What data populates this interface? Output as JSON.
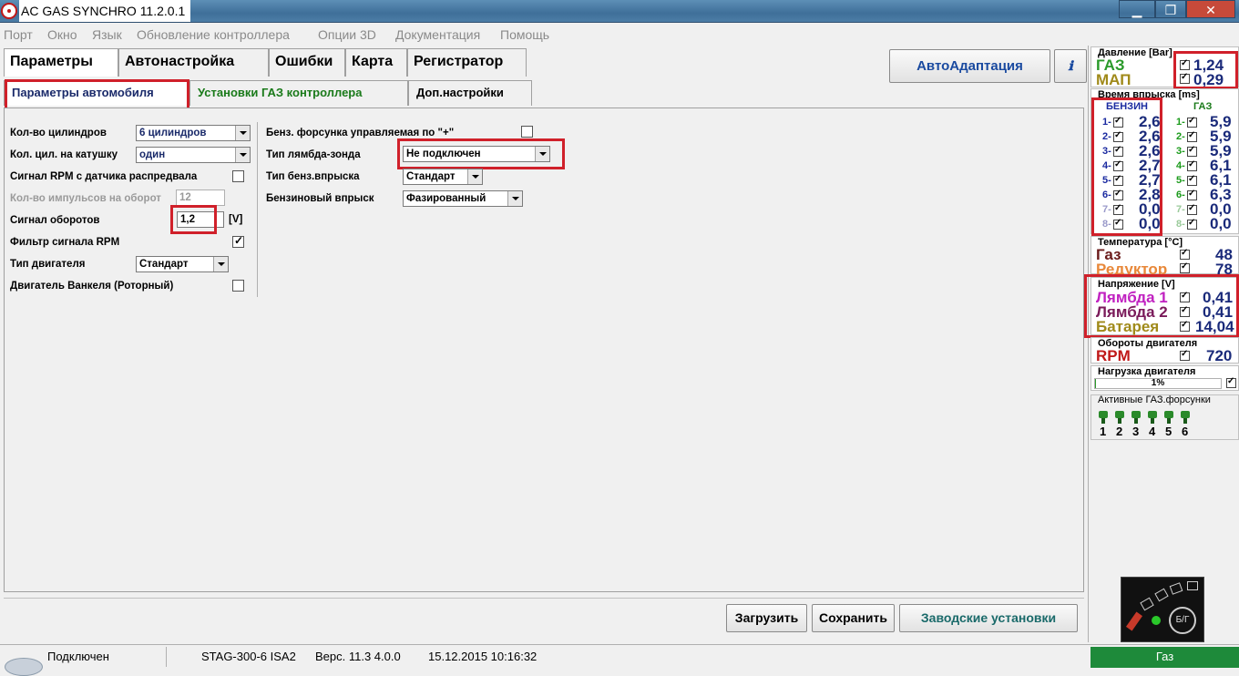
{
  "window": {
    "title": "AC GAS SYNCHRO  11.2.0.1",
    "btn_min": "▁",
    "btn_max": "❐",
    "btn_close": "✕"
  },
  "menu": [
    "Порт",
    "Окно",
    "Язык",
    "Обновление контроллера",
    "Опции 3D",
    "Документация",
    "Помощь"
  ],
  "main_tabs": [
    "Параметры",
    "Автонастройка",
    "Ошибки",
    "Карта",
    "Регистратор"
  ],
  "autoadapt_label": "АвтоАдаптация",
  "sub_tabs": [
    "Параметры автомобиля",
    "Установки ГАЗ контроллера",
    "Доп.настройки"
  ],
  "left": {
    "cyl_label": "Кол-во цилиндров",
    "cyl_value": "6 цилиндров",
    "coil_label": "Кол. цил. на катушку",
    "coil_value": "один",
    "rpm_cam_label": "Сигнал RPM с датчика распредвала",
    "pulses_label": "Кол-во импульсов на оборот",
    "pulses_value": "12",
    "rpm_signal_label": "Сигнал оборотов",
    "rpm_signal_value": "1,2",
    "rpm_signal_unit": "[V]",
    "rpm_filter_label": "Фильтр сигнала RPM",
    "engine_type_label": "Тип двигателя",
    "engine_type_value": "Стандарт",
    "wankel_label": "Двигатель Ванкеля (Роторный)"
  },
  "right": {
    "injector_plus_label": "Бенз. форсунка управляемая по \"+\"",
    "lambda_label": "Тип лямбда-зонда",
    "lambda_value": "Не подключен",
    "petrol_inj_type_label": "Тип бенз.впрыска",
    "petrol_inj_type_value": "Стандарт",
    "petrol_inj_label": "Бензиновый впрыск",
    "petrol_inj_value": "Фазированный"
  },
  "buttons": {
    "load": "Загрузить",
    "save": "Сохранить",
    "factory": "Заводские установки"
  },
  "pressure": {
    "title": "Давление [Bar]",
    "gas_label": "ГАЗ",
    "gas_value": "1,24",
    "map_label": "МАП",
    "map_value": "0,29"
  },
  "injection": {
    "title": "Время впрыска [ms]",
    "petrol_header": "БЕНЗИН",
    "gas_header": "ГАЗ",
    "petrol": [
      {
        "n": "1-",
        "v": "2,6"
      },
      {
        "n": "2-",
        "v": "2,6"
      },
      {
        "n": "3-",
        "v": "2,6"
      },
      {
        "n": "4-",
        "v": "2,7"
      },
      {
        "n": "5-",
        "v": "2,7"
      },
      {
        "n": "6-",
        "v": "2,8"
      },
      {
        "n": "7-",
        "v": "0,0"
      },
      {
        "n": "8-",
        "v": "0,0"
      }
    ],
    "gas": [
      {
        "n": "1-",
        "v": "5,9"
      },
      {
        "n": "2-",
        "v": "5,9"
      },
      {
        "n": "3-",
        "v": "5,9"
      },
      {
        "n": "4-",
        "v": "6,1"
      },
      {
        "n": "5-",
        "v": "6,1"
      },
      {
        "n": "6-",
        "v": "6,3"
      },
      {
        "n": "7-",
        "v": "0,0"
      },
      {
        "n": "8-",
        "v": "0,0"
      }
    ]
  },
  "temperature": {
    "title": "Температура  [°C]",
    "gas_label": "Газ",
    "gas_value": "48",
    "reducer_label": "Редуктор",
    "reducer_value": "78"
  },
  "voltage": {
    "title": "Напряжение [V]",
    "l1_label": "Лямбда 1",
    "l1_value": "0,41",
    "l2_label": "Лямбда 2",
    "l2_value": "0,41",
    "bat_label": "Батарея",
    "bat_value": "14,04"
  },
  "rpm": {
    "title": "Обороты двигателя",
    "label": "RPM",
    "value": "720"
  },
  "load": {
    "title": "Нагрузка двигателя",
    "value": "1%",
    "fraction": 0.01
  },
  "active": {
    "title": "Активные ГАЗ.форсунки",
    "nums": [
      "1",
      "2",
      "3",
      "4",
      "5",
      "6"
    ]
  },
  "switch_label": "Б/Г",
  "status": {
    "connection": "Подключен",
    "device": "STAG-300-6 ISA2",
    "version": "Верс. 11.3  4.0.0",
    "datetime": "15.12.2015 10:16:32",
    "mode": "Газ"
  }
}
